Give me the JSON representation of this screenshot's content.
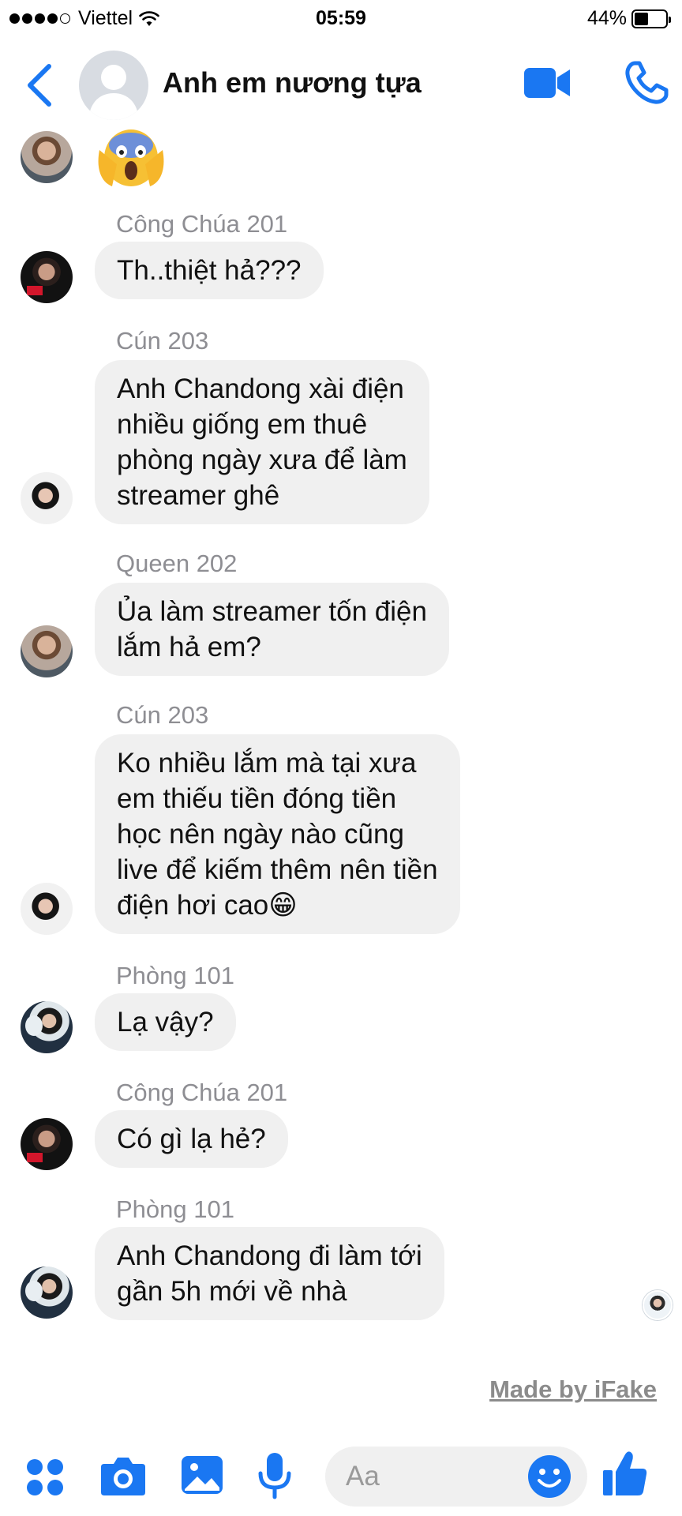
{
  "status_bar": {
    "carrier": "Viettel",
    "time": "05:59",
    "battery": "44%",
    "battery_level": 0.44
  },
  "header": {
    "title": "Anh em nương tựa"
  },
  "messages": [
    {
      "sender": "",
      "emoji": "😱"
    },
    {
      "sender": "Công Chúa 201",
      "lines": [
        "Th..thiệt hả???"
      ]
    },
    {
      "sender": "Cún 203",
      "lines": [
        "Anh Chandong xài điện",
        "nhiều giống em thuê",
        "phòng ngày xưa để làm",
        "streamer ghê"
      ]
    },
    {
      "sender": "Queen 202",
      "lines": [
        "Ủa làm streamer tốn điện",
        "lắm hả em?"
      ]
    },
    {
      "sender": "Cún 203",
      "lines": [
        "Ko nhiều lắm mà tại xưa",
        "em thiếu tiền đóng tiền",
        "học nên ngày nào cũng",
        "live để kiếm thêm nên tiền",
        "điện hơi cao😁"
      ]
    },
    {
      "sender": "Phòng 101",
      "lines": [
        "Lạ vậy?"
      ]
    },
    {
      "sender": "Công Chúa 201",
      "lines": [
        "Có gì lạ hẻ?"
      ]
    },
    {
      "sender": "Phòng 101",
      "lines": [
        "Anh Chandong đi làm tới",
        "gần 5h mới về nhà"
      ]
    }
  ],
  "watermark": "Made by iFake",
  "composer": {
    "placeholder": "Aa"
  },
  "colors": {
    "accent": "#1a77f2",
    "bubble": "#f0f0f0",
    "sender": "#8e8e93"
  },
  "icons": [
    "back-icon",
    "video-call-icon",
    "phone-icon",
    "menu-dots-icon",
    "camera-icon",
    "image-icon",
    "microphone-icon",
    "smiley-icon",
    "thumbs-up-icon"
  ]
}
